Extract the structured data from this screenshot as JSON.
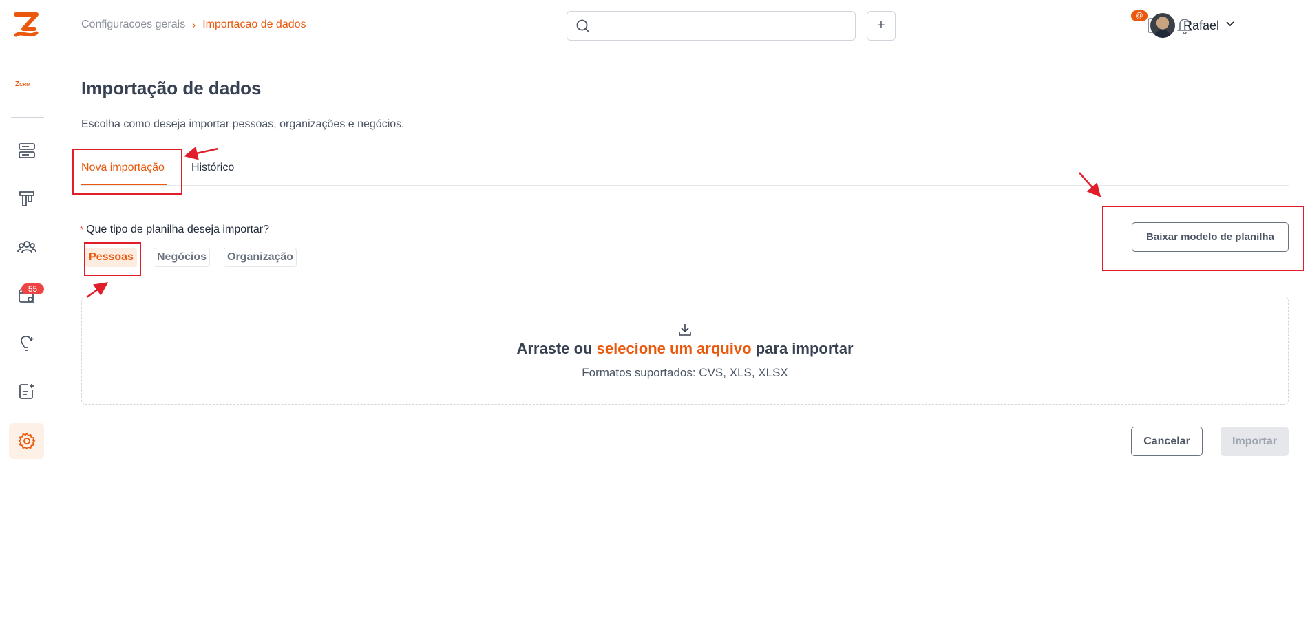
{
  "app": {
    "name": "ZCRM",
    "logo_letter": "Z",
    "brand_color": "#ea580c"
  },
  "header": {
    "breadcrumb": [
      "Configuracoes gerais",
      "Importacao de dados"
    ],
    "breadcrumb_separator": "›",
    "search": {
      "placeholder": "",
      "value": ""
    },
    "add_label": "+",
    "notification_badge": "@",
    "user": {
      "name": "Rafael"
    }
  },
  "sidebar": {
    "brand": {
      "z": "Z",
      "crm": "CRM"
    },
    "items": [
      {
        "icon": "server-icon"
      },
      {
        "icon": "kanban-icon"
      },
      {
        "icon": "users-icon"
      },
      {
        "icon": "calendar-search-icon",
        "badge": "55"
      },
      {
        "icon": "lightbulb-icon"
      },
      {
        "icon": "notes-icon"
      },
      {
        "icon": "gear-icon",
        "active": true
      }
    ]
  },
  "main": {
    "title": "Importação de dados",
    "subtitle": "Escolha como deseja importar pessoas, organizações e negócios.",
    "tabs": [
      {
        "label": "Nova importação",
        "active": true
      },
      {
        "label": "Histórico",
        "active": false
      }
    ],
    "question": {
      "required_mark": "*",
      "label": "Que tipo de planilha deseja importar?"
    },
    "types": [
      {
        "label": "Pessoas",
        "selected": true
      },
      {
        "label": "Negócios",
        "selected": false
      },
      {
        "label": "Organização",
        "selected": false
      }
    ],
    "download_label": "Baixar modelo de planilha",
    "dropzone": {
      "title_before": "Arraste ou",
      "title_link": "selecione um arquivo",
      "title_after": "para importar",
      "formats": "Formatos suportados: CVS, XLS, XLSX"
    },
    "cancel_label": "Cancelar",
    "import_label": "Importar"
  }
}
